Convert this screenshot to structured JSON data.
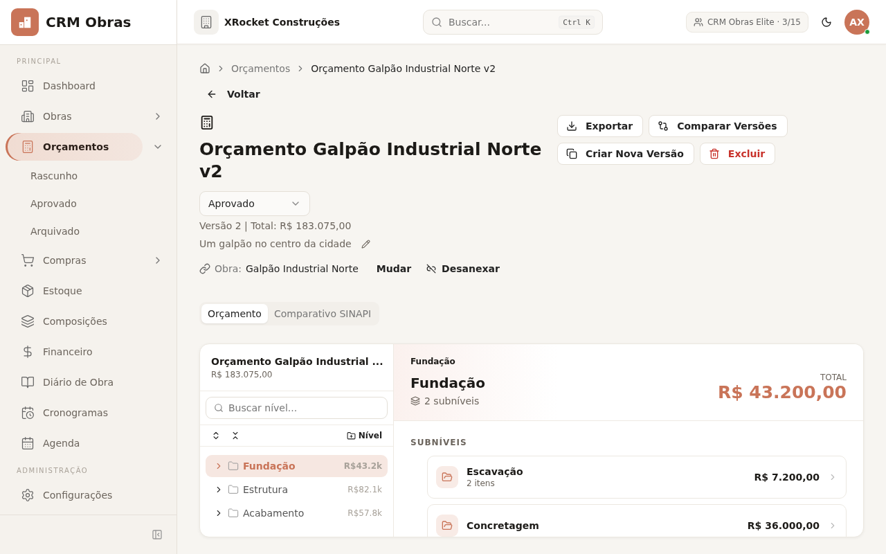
{
  "sidebar": {
    "brand": "CRM Obras",
    "sections": [
      {
        "label": "PRINCIPAL",
        "items": [
          {
            "label": "Dashboard",
            "kind": "link",
            "selected": false
          },
          {
            "label": "Obras",
            "kind": "group",
            "selected": false,
            "expanded": false
          },
          {
            "label": "Orçamentos",
            "kind": "group",
            "selected": true,
            "expanded": true,
            "children": [
              {
                "label": "Rascunho",
                "selected": false
              },
              {
                "label": "Aprovado",
                "selected": false
              },
              {
                "label": "Arquivado",
                "selected": false
              }
            ]
          },
          {
            "label": "Compras",
            "kind": "group",
            "selected": false,
            "expanded": false
          },
          {
            "label": "Estoque",
            "kind": "link",
            "selected": false
          },
          {
            "label": "Composições",
            "kind": "link",
            "selected": false
          },
          {
            "label": "Financeiro",
            "kind": "link",
            "selected": false
          },
          {
            "label": "Diário de Obra",
            "kind": "link",
            "selected": false
          },
          {
            "label": "Cronogramas",
            "kind": "link",
            "selected": false
          },
          {
            "label": "Agenda",
            "kind": "link",
            "selected": false
          }
        ]
      },
      {
        "label": "ADMINISTRAÇÃO",
        "items": [
          {
            "label": "Configurações",
            "kind": "link",
            "selected": false
          }
        ]
      }
    ]
  },
  "header": {
    "company": "XRocket Construções",
    "search": {
      "placeholder": "Buscar...",
      "shortcut": [
        "Ctrl",
        "K"
      ]
    },
    "plan": "CRM Obras Elite · 3/15",
    "avatar": {
      "initials": "AX",
      "online": true
    }
  },
  "breadcrumb": [
    "Orçamentos",
    "Orçamento Galpão Industrial Norte v2"
  ],
  "back": "Voltar",
  "budget": {
    "title": "Orçamento Galpão Industrial Norte v2",
    "status": "Aprovado",
    "meta": "Versão 2 | Total: R$ 183.075,00",
    "description": "Um galpão no centro da cidade",
    "obra_label": "Obra:",
    "obra": "Galpão Industrial Norte",
    "obra_actions": [
      {
        "label": "Mudar",
        "kind": "change"
      },
      {
        "label": "Desanexar",
        "kind": "detach"
      }
    ]
  },
  "actions": [
    {
      "label": "Exportar",
      "kind": "export"
    },
    {
      "label": "Comparar Versões",
      "kind": "compare"
    },
    {
      "label": "Criar Nova Versão",
      "kind": "copy"
    },
    {
      "label": "Excluir",
      "kind": "delete"
    }
  ],
  "tabs": [
    {
      "label": "Orçamento",
      "selected": true
    },
    {
      "label": "Comparativo SINAPI",
      "selected": false
    }
  ],
  "tree": {
    "title": "Orçamento Galpão Industrial ...",
    "total": "R$ 183.075,00",
    "search": {
      "placeholder": "Buscar nível..."
    },
    "add": "Nível",
    "levels": [
      {
        "name": "Fundação",
        "amount": "R$43.2k",
        "selected": true
      },
      {
        "name": "Estrutura",
        "amount": "R$82.1k",
        "selected": false
      },
      {
        "name": "Acabamento",
        "amount": "R$57.8k",
        "selected": false
      }
    ]
  },
  "detail": {
    "crumb": "Fundação",
    "title": "Fundação",
    "count": "2 subníveis",
    "total_label": "TOTAL",
    "total": "R$ 43.200,00",
    "section": "SUBNÍVEIS",
    "sublevels": [
      {
        "name": "Escavação",
        "count": "2 itens",
        "amount": "R$ 7.200,00"
      },
      {
        "name": "Concretagem",
        "amount": "R$ 36.000,00"
      }
    ]
  }
}
